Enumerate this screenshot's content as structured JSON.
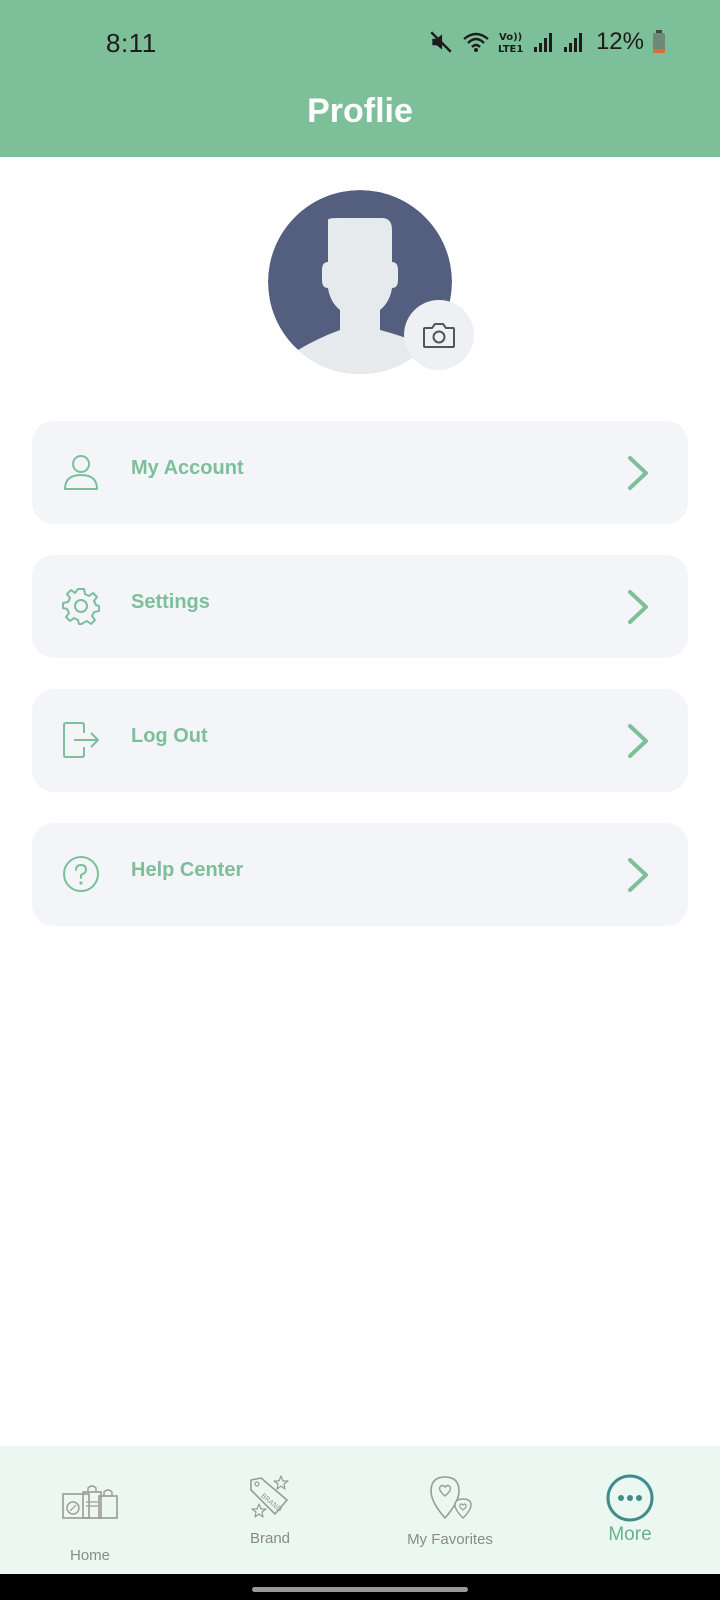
{
  "status_bar": {
    "time": "8:11",
    "battery": "12%",
    "network_label": "Vo)) LTE1"
  },
  "header": {
    "title": "Proflie"
  },
  "colors": {
    "accent": "#7dbf99",
    "avatar_bg": "#545f80",
    "card_bg": "#f3f5f9",
    "nav_bg": "#ebf8f1"
  },
  "menu": {
    "items": [
      {
        "label": "My Account",
        "icon": "user-icon"
      },
      {
        "label": "Settings",
        "icon": "gear-icon"
      },
      {
        "label": "Log Out",
        "icon": "logout-icon"
      },
      {
        "label": "Help Center",
        "icon": "help-icon"
      }
    ]
  },
  "bottom_nav": {
    "items": [
      {
        "label": "Home",
        "icon": "shopping-home-icon"
      },
      {
        "label": "Brand",
        "icon": "brand-tag-icon"
      },
      {
        "label": "My Favorites",
        "icon": "favorites-pin-icon"
      },
      {
        "label": "More",
        "icon": "more-icon",
        "active": true
      }
    ]
  }
}
